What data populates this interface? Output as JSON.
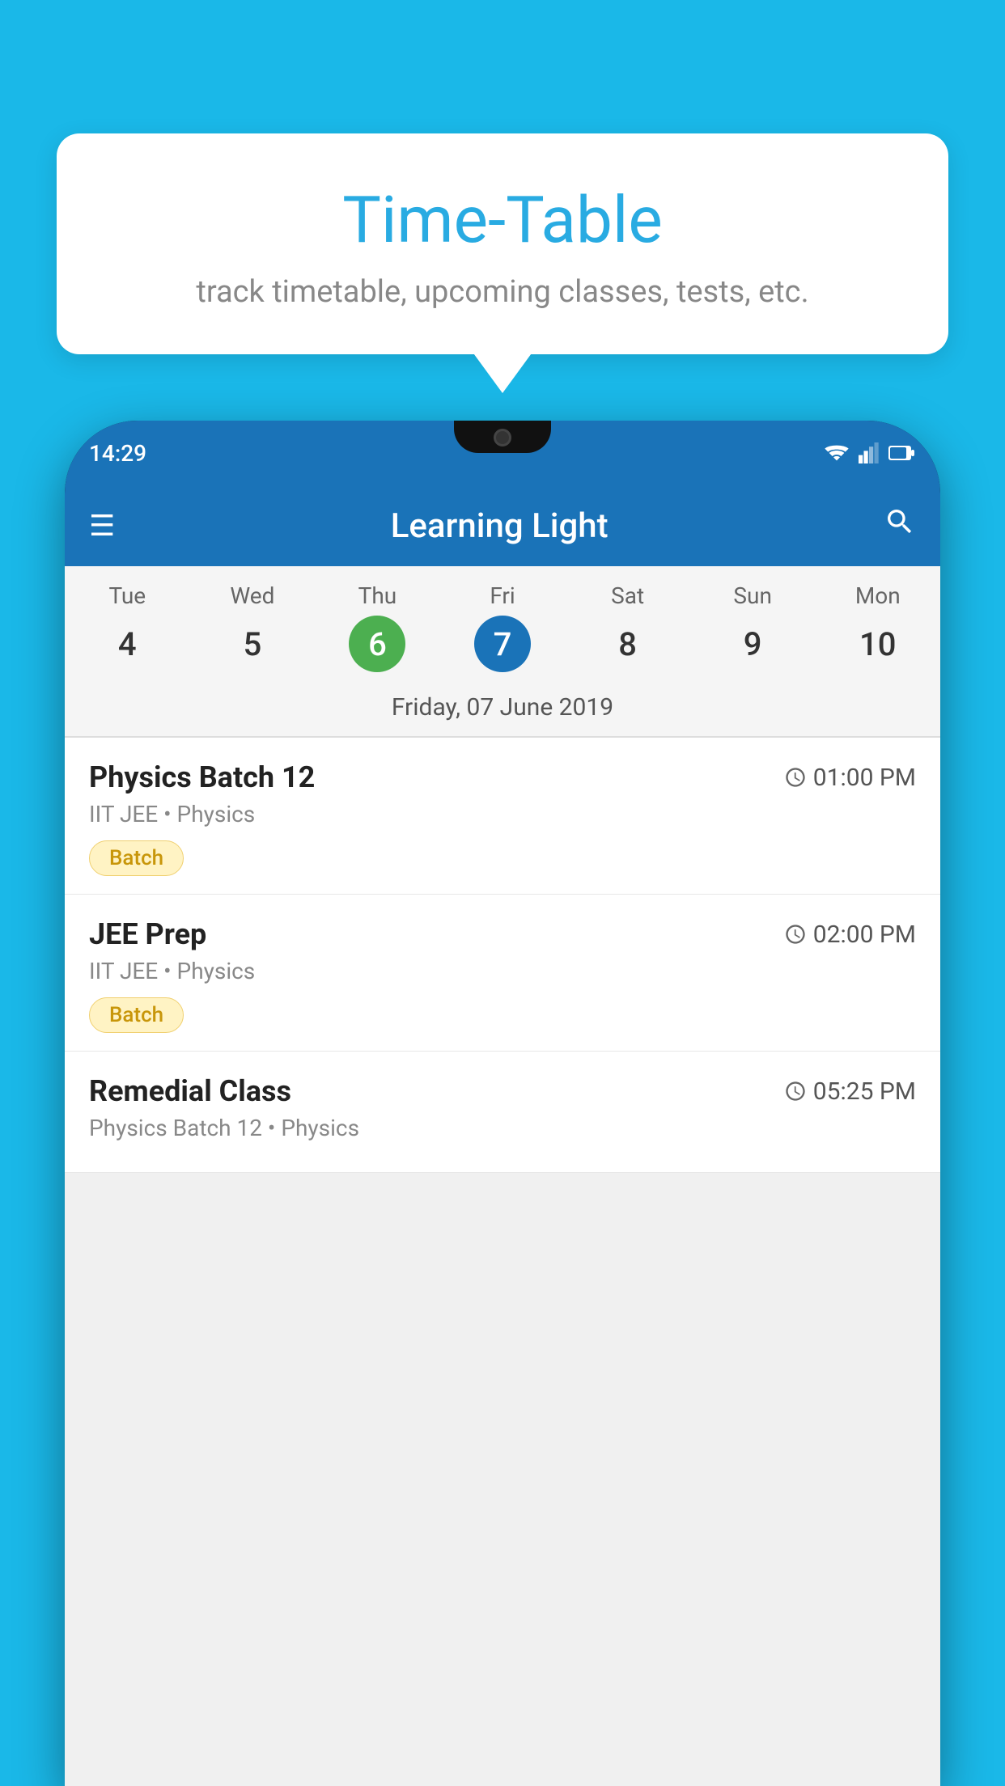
{
  "background_color": "#1ab8e8",
  "speech_bubble": {
    "title": "Time-Table",
    "subtitle": "track timetable, upcoming classes, tests, etc."
  },
  "phone": {
    "status_bar": {
      "time": "14:29"
    },
    "app_bar": {
      "title": "Learning Light",
      "menu_icon": "☰",
      "search_icon": "🔍"
    },
    "calendar": {
      "days": [
        {
          "name": "Tue",
          "num": "4",
          "state": "normal"
        },
        {
          "name": "Wed",
          "num": "5",
          "state": "normal"
        },
        {
          "name": "Thu",
          "num": "6",
          "state": "today"
        },
        {
          "name": "Fri",
          "num": "7",
          "state": "selected"
        },
        {
          "name": "Sat",
          "num": "8",
          "state": "normal"
        },
        {
          "name": "Sun",
          "num": "9",
          "state": "normal"
        },
        {
          "name": "Mon",
          "num": "10",
          "state": "normal"
        }
      ],
      "selected_date_label": "Friday, 07 June 2019"
    },
    "classes": [
      {
        "name": "Physics Batch 12",
        "time": "01:00 PM",
        "meta": "IIT JEE • Physics",
        "badge": "Batch"
      },
      {
        "name": "JEE Prep",
        "time": "02:00 PM",
        "meta": "IIT JEE • Physics",
        "badge": "Batch"
      },
      {
        "name": "Remedial Class",
        "time": "05:25 PM",
        "meta": "Physics Batch 12 • Physics",
        "badge": null
      }
    ]
  }
}
